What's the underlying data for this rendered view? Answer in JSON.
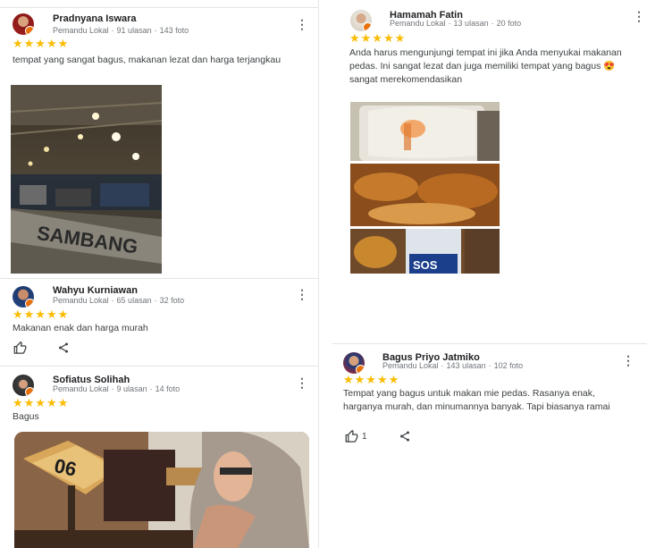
{
  "reviews": [
    {
      "name": "Pradnyana Iswara",
      "role": "Pemandu Lokal",
      "reviews_count": "91 ulasan",
      "photos_count": "143 foto",
      "stars": "★★★★★",
      "text": "tempat yang sangat bagus, makanan lezat dan harga terjangkau",
      "photo_caption": "SAMBANG"
    },
    {
      "name": "Wahyu Kurniawan",
      "role": "Pemandu Lokal",
      "reviews_count": "65 ulasan",
      "photos_count": "32 foto",
      "stars": "★★★★★",
      "text": "Makanan enak dan harga murah"
    },
    {
      "name": "Sofiatus Solihah",
      "role": "Pemandu Lokal",
      "reviews_count": "9 ulasan",
      "photos_count": "14 foto",
      "stars": "★★★★★",
      "text": "Bagus",
      "photo_table_number": "06"
    },
    {
      "name": "Hamamah Fatin",
      "role": "Pemandu Lokal",
      "reviews_count": "13 ulasan",
      "photos_count": "20 foto",
      "stars": "★★★★★",
      "text": "Anda harus mengunjungi tempat ini jika Anda menyukai makanan pedas. Ini sangat lezat dan juga memiliki tempat yang bagus 😍 sangat merekomendasikan",
      "photo_brand": "SOS"
    },
    {
      "name": "Bagus Priyo Jatmiko",
      "role": "Pemandu Lokal",
      "reviews_count": "143 ulasan",
      "photos_count": "102 foto",
      "stars": "★★★★★",
      "text": "Tempat yang bagus untuk makan mie pedas. Rasanya enak, harganya murah, dan minumannya banyak. Tapi biasanya ramai",
      "like_count": "1"
    }
  ],
  "separator": "·",
  "kebab": "⋮",
  "colors": {
    "star": "#fbbc04",
    "badge": "#e8710a",
    "meta": "#70757a"
  },
  "icons": {
    "like": "thumb-up-icon",
    "share": "share-icon",
    "menu": "more-vert-icon"
  }
}
